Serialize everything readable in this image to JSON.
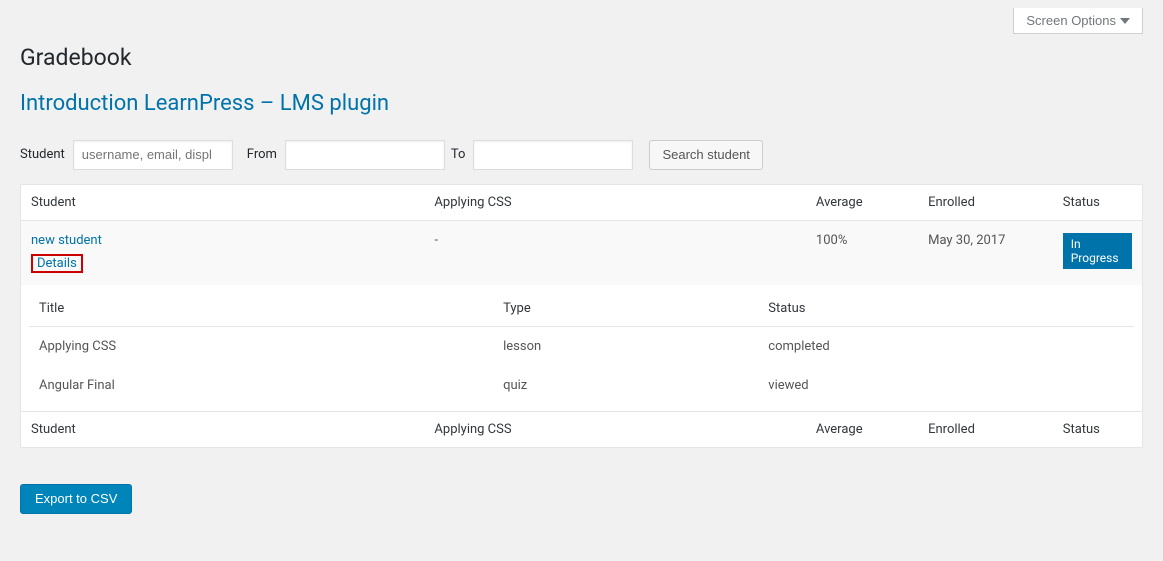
{
  "screen_options_label": "Screen Options",
  "page_title": "Gradebook",
  "course_title": "Introduction LearnPress – LMS plugin",
  "filters": {
    "student_label": "Student",
    "student_placeholder": "username, email, displ",
    "from_label": "From",
    "to_label": "To",
    "search_button": "Search student"
  },
  "columns": {
    "student": "Student",
    "col1": "Applying CSS",
    "average": "Average",
    "enrolled": "Enrolled",
    "status": "Status"
  },
  "rows": [
    {
      "student_name": "new student",
      "details_label": "Details",
      "col1_value": "-",
      "average": "100%",
      "enrolled": "May 30, 2017",
      "status": "In Progress"
    }
  ],
  "details_table": {
    "columns": {
      "title": "Title",
      "type": "Type",
      "status": "Status"
    },
    "rows": [
      {
        "title": "Applying CSS",
        "type": "lesson",
        "status": "completed"
      },
      {
        "title": "Angular Final",
        "type": "quiz",
        "status": "viewed"
      }
    ]
  },
  "export_button": "Export to CSV"
}
